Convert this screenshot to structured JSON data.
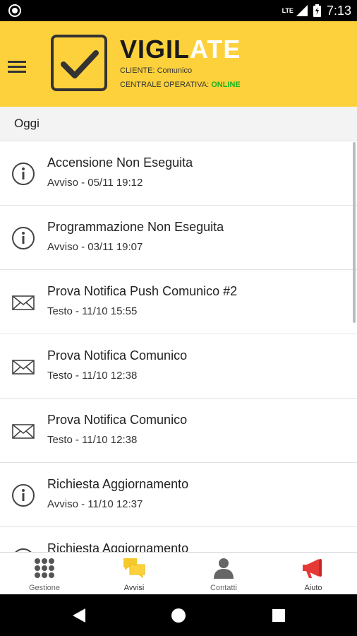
{
  "status_bar": {
    "network": "LTE",
    "time": "7:13"
  },
  "header": {
    "logo_text_dark": "VIGIL",
    "logo_text_light": "ATE",
    "client_label": "CLIENTE: Comunico",
    "central_label": "CENTRALE OPERATIVA:",
    "central_status": "ONLINE",
    "accent_color": "#fdd13c",
    "status_color": "#1db31d"
  },
  "list": {
    "section_label": "Oggi",
    "items": [
      {
        "icon": "info-icon",
        "title": "Accensione Non Eseguita",
        "subtitle": "Avviso - 05/11 19:12"
      },
      {
        "icon": "info-icon",
        "title": "Programmazione Non Eseguita",
        "subtitle": "Avviso - 03/11 19:07"
      },
      {
        "icon": "mail-icon",
        "title": "Prova Notifica Push Comunico #2",
        "subtitle": "Testo - 11/10 15:55"
      },
      {
        "icon": "mail-icon",
        "title": "Prova Notifica Comunico",
        "subtitle": "Testo - 11/10 12:38"
      },
      {
        "icon": "mail-icon",
        "title": "Prova Notifica Comunico",
        "subtitle": "Testo - 11/10 12:38"
      },
      {
        "icon": "info-icon",
        "title": "Richiesta Aggiornamento",
        "subtitle": "Avviso - 11/10 12:37"
      },
      {
        "icon": "info-icon",
        "title": "Richiesta Aggiornamento",
        "subtitle": ""
      }
    ]
  },
  "bottom_nav": {
    "items": [
      {
        "label": "Gestione",
        "icon": "grid-icon",
        "color": "#555555"
      },
      {
        "label": "Avvisi",
        "icon": "chat-bubbles-icon",
        "color": "#fdd13c",
        "active": true
      },
      {
        "label": "Contatti",
        "icon": "person-icon",
        "color": "#555555"
      },
      {
        "label": "Aiuto",
        "icon": "megaphone-icon",
        "color": "#e53935"
      }
    ]
  }
}
